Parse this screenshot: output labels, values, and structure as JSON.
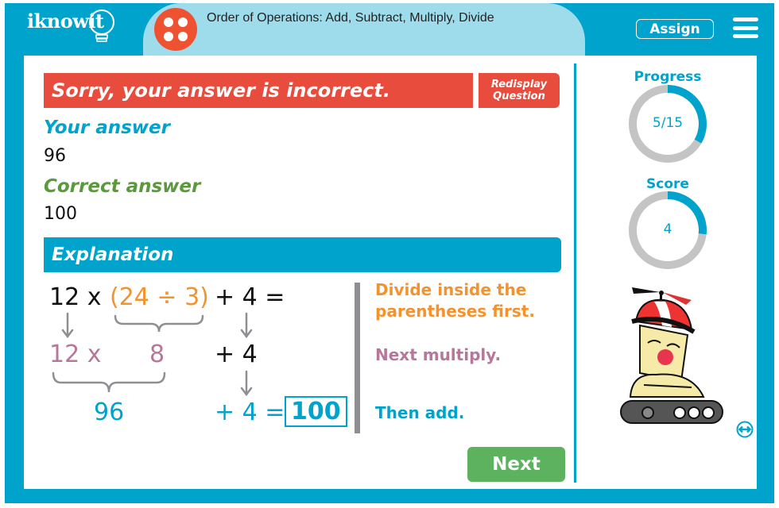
{
  "header": {
    "logo_text": "iknowit",
    "lesson_title": "Order of Operations: Add, Subtract, Multiply, Divide",
    "lesson_icon": "four-dots-icon",
    "assign_label": "Assign",
    "menu_icon": "hamburger-menu-icon"
  },
  "feedback": {
    "banner_text": "Sorry, your answer is incorrect.",
    "redisplay_line1": "Redisplay",
    "redisplay_line2": "Question",
    "your_answer_label": "Your answer",
    "your_answer_value": "96",
    "correct_answer_label": "Correct answer",
    "correct_answer_value": "100"
  },
  "explanation": {
    "title": "Explanation",
    "row1": {
      "a": "12 x",
      "paren": "(24 ÷ 3)",
      "b": "+ 4 ="
    },
    "row2": {
      "a": "12 x",
      "b": "8",
      "c": "+ 4"
    },
    "row3": {
      "a": "96",
      "b": "+ 4 =",
      "result": "100"
    },
    "steps": [
      "Divide inside the parentheses first.",
      "Next multiply.",
      "Then add."
    ]
  },
  "sidebar": {
    "progress_label": "Progress",
    "progress_text": "5/15",
    "progress_fraction": 0.3333,
    "score_label": "Score",
    "score_text": "4",
    "score_fraction": 0.2667
  },
  "colors": {
    "brand": "#00a3cc",
    "error": "#e84c3d",
    "correct": "#5a9a3c",
    "step1": "#f4922e",
    "step2": "#b8779a",
    "next": "#5cb25e"
  },
  "next_label": "Next"
}
